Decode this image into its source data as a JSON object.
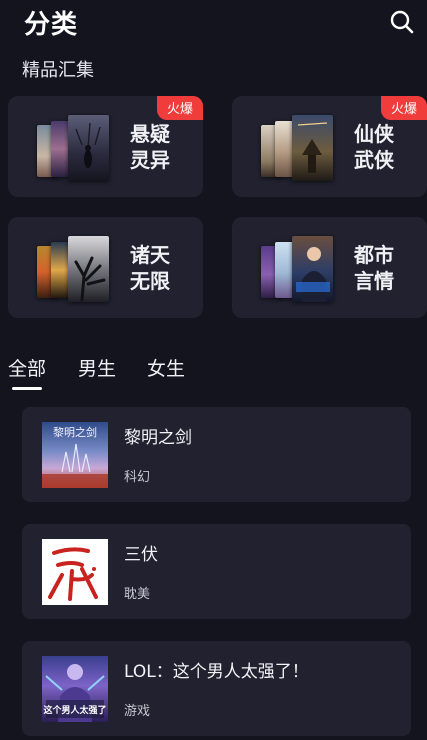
{
  "header": {
    "title": "分类",
    "search_icon": "search-icon"
  },
  "featured": {
    "section_title": "精品汇集",
    "cards": [
      {
        "name_line1": "悬疑",
        "name_line2": "灵异",
        "badge": "火爆"
      },
      {
        "name_line1": "仙侠",
        "name_line2": "武侠",
        "badge": "火爆"
      },
      {
        "name_line1": "诸天",
        "name_line2": "无限"
      },
      {
        "name_line1": "都市",
        "name_line2": "言情"
      }
    ]
  },
  "tabs": [
    {
      "label": "全部",
      "active": true
    },
    {
      "label": "男生"
    },
    {
      "label": "女生"
    }
  ],
  "books": [
    {
      "title": "黎明之剑",
      "tag": "科幻",
      "cover_text": "黎明之剑"
    },
    {
      "title": "三伏",
      "tag": "耽美"
    },
    {
      "title": "LOL：这个男人太强了！",
      "tag": "游戏",
      "cover_text": "这个男人太强了"
    }
  ],
  "colors": {
    "background": "#14141f",
    "card": "#21212f",
    "badge": "#f13c3c"
  }
}
